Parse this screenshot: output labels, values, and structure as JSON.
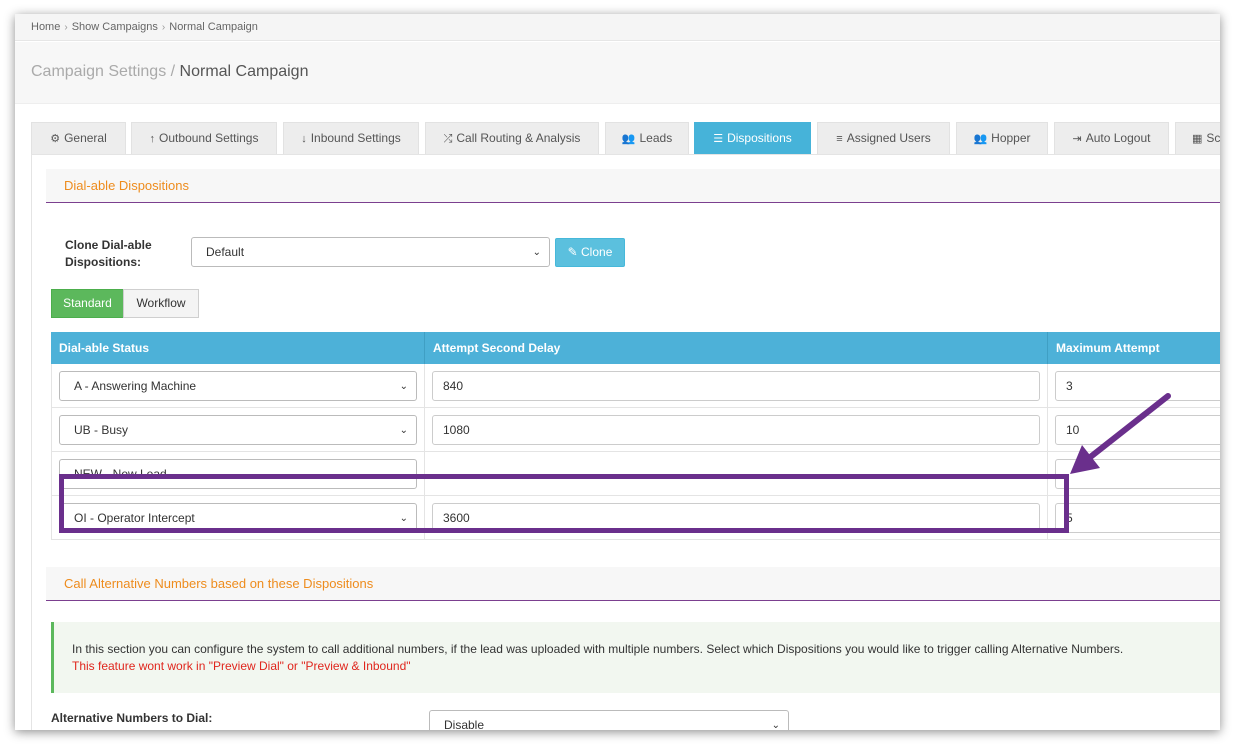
{
  "breadcrumb": [
    "Home",
    "Show Campaigns",
    "Normal Campaign"
  ],
  "page": {
    "title_prefix": "Campaign Settings / ",
    "title_name": "Normal Campaign"
  },
  "tabs": [
    {
      "label": "General",
      "icon": "cogs-icon",
      "active": false
    },
    {
      "label": "Outbound Settings",
      "icon": "arrow-up-icon",
      "active": false
    },
    {
      "label": "Inbound Settings",
      "icon": "arrow-down-icon",
      "active": false
    },
    {
      "label": "Call Routing & Analysis",
      "icon": "random-icon",
      "active": false
    },
    {
      "label": "Leads",
      "icon": "users-icon",
      "active": false
    },
    {
      "label": "Dispositions",
      "icon": "list-icon",
      "active": true
    },
    {
      "label": "Assigned Users",
      "icon": "list-ol-icon",
      "active": false
    },
    {
      "label": "Hopper",
      "icon": "users-icon",
      "active": false
    },
    {
      "label": "Auto Logout",
      "icon": "sign-out-icon",
      "active": false
    },
    {
      "label": "Sc",
      "icon": "calendar-icon",
      "active": false
    }
  ],
  "dialable": {
    "section_title": "Dial-able Dispositions",
    "clone_label": "Clone Dial-able Dispositions:",
    "clone_select_value": "Default",
    "clone_button": "Clone",
    "mode_standard": "Standard",
    "mode_workflow": "Workflow",
    "columns": [
      "Dial-able Status",
      "Attempt Second Delay",
      "Maximum Attempt"
    ],
    "rows": [
      {
        "status": "A - Answering Machine",
        "delay": "840",
        "max": "3"
      },
      {
        "status": "UB - Busy",
        "delay": "1080",
        "max": "10"
      },
      {
        "status": "NEW - New Lead",
        "delay": "",
        "max": ""
      },
      {
        "status": "OI - Operator Intercept",
        "delay": "3600",
        "max": "5"
      }
    ]
  },
  "alternative": {
    "section_title": "Call Alternative Numbers based on these Dispositions",
    "info_text": "In this section you can configure the system to call additional numbers, if the lead was uploaded with multiple numbers. Select which Dispositions you would like to trigger calling Alternative Numbers.",
    "warning_text": "This feature wont work in \"Preview Dial\" or \"Preview & Inbound\"",
    "dial_label": "Alternative Numbers to Dial:",
    "dial_value": "Disable"
  },
  "colors": {
    "accent": "#46b3d9",
    "highlight": "#6a2f8c",
    "section_title": "#ee8c1d",
    "success": "#5cb85c",
    "warning": "#e0261d"
  }
}
